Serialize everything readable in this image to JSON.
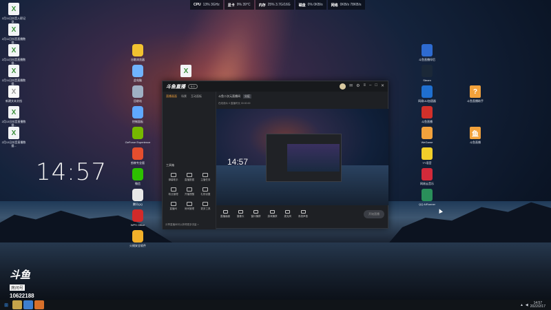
{
  "desktop": {
    "clock": "14:57",
    "left_icons": [
      {
        "label": "2月11日抖音入职记录...",
        "glyph": "doc-icon"
      },
      {
        "label": "2月11日抖音直播数据...",
        "glyph": "doc-icon"
      },
      {
        "label": "2月11日抖音直播数据...",
        "glyph": "doc-icon"
      },
      {
        "label": "2月11日抖音直播数据...",
        "glyph": "doc-icon"
      },
      {
        "label": "新建文本文档",
        "glyph": "text-doc-icon"
      },
      {
        "label": "2月13日抖音直播数据...",
        "glyph": "doc-icon"
      },
      {
        "label": "2月13日抖音直播数据...",
        "glyph": "doc-icon"
      }
    ],
    "middle_icons": [
      {
        "label": "谷歌浏览器",
        "glyph": "chrome-icon"
      },
      {
        "label": "此电脑",
        "glyph": "computer-icon"
      },
      {
        "label": "回收站",
        "glyph": "recycle-bin-icon"
      },
      {
        "label": "控制面板",
        "glyph": "control-panel-icon"
      },
      {
        "label": "GeForce Experience",
        "glyph": "nvidia-icon"
      },
      {
        "label": "剪映专业版",
        "glyph": "video-editor-icon"
      },
      {
        "label": "微信",
        "glyph": "wechat-icon"
      },
      {
        "label": "腾讯QQ",
        "glyph": "qq-icon"
      },
      {
        "label": "WPS Office",
        "glyph": "wps-icon"
      },
      {
        "label": "火绒安全软件",
        "glyph": "security-icon"
      }
    ],
    "right_icons_a": [
      {
        "label": "斗鱼直播伴侣",
        "glyph": "app-icon"
      },
      {
        "label": "Steam",
        "glyph": "steam-icon"
      },
      {
        "label": "网易UU加速器",
        "glyph": "accelerator-icon"
      },
      {
        "label": "斗鱼直播",
        "glyph": "live-icon"
      },
      {
        "label": "WeGame",
        "glyph": "wegame-icon"
      },
      {
        "label": "YY语音",
        "glyph": "yy-icon"
      },
      {
        "label": "网易云音乐",
        "glyph": "music-icon"
      },
      {
        "label": "QQ AIRunner",
        "glyph": "ai-icon"
      }
    ],
    "right_icons_b": [
      {
        "label": "斗鱼直播助手",
        "glyph": "help-icon"
      },
      {
        "label": "斗鱼直播",
        "glyph": "douyu-icon"
      }
    ]
  },
  "monitor": {
    "cpu_label": "CPU",
    "cpu_value": "13%  3GHz",
    "gpu_label": "显卡",
    "gpu_value": "9%  39°C",
    "mem_label": "内存",
    "mem_value": "25%  3.7G/16G",
    "disk_label": "磁盘",
    "disk_value": "0%  0KB/s",
    "net_label": "网络",
    "net_value": "0KB/s  78KB/s"
  },
  "watermark": {
    "logo": "斗鱼",
    "sub": "房间号",
    "room": "10622188"
  },
  "app": {
    "title": "斗鱼直播",
    "version": "5.0",
    "left_tabs": [
      "直播画面",
      "场景",
      "互动面板"
    ],
    "tools_heading": "工具箱",
    "tools": [
      "弹幕助手",
      "直播数据",
      "主播任务",
      "粉丝管理",
      "开播提醒",
      "礼物设置",
      "直播间",
      "房间管理",
      "更多工具"
    ],
    "footer": "分享直播间可以获得更多流量 >",
    "room_title": "斗鱼二次元直播间",
    "room_tag": "分区",
    "room_sub": "在线观众  0   直播时长  00:00:00",
    "preview_clock": "14:57",
    "bottom_tools": [
      "直播画面",
      "摄像头",
      "窗口捕获",
      "游戏捕获",
      "麦克风",
      "系统声音"
    ],
    "go_live": "开始直播"
  },
  "taskbar": {
    "time": "14:57",
    "date": "2022/2/17"
  }
}
